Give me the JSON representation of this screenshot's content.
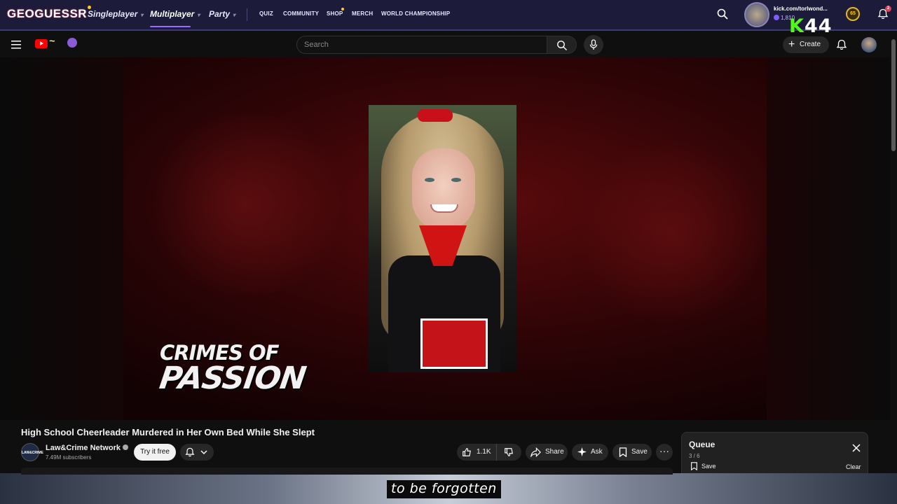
{
  "geo": {
    "logo": "GEOGUESSR",
    "nav": [
      "Singleplayer",
      "Multiplayer",
      "Party"
    ],
    "small_nav": [
      "QUIZ",
      "COMMUNITY",
      "SHOP",
      "MERCH",
      "WORLD CHAMPIONSHIP"
    ],
    "user": "kick.com/torlwond...",
    "coins": "1,810",
    "level": "65",
    "notifications": "2",
    "kick_overlay": {
      "k": "K",
      "count": "44"
    }
  },
  "yt": {
    "search_placeholder": "Search",
    "create_label": "Create"
  },
  "video": {
    "overlay_line1": "CRIMES OF",
    "overlay_line2": "PASSION",
    "title": "High School Cheerleader Murdered in Her Own Bed While She Slept",
    "channel": "Law&Crime Network",
    "channel_avatar": "LAW&CRIME",
    "subscribers": "7.49M subscribers",
    "try_label": "Try it free",
    "likes": "1.1K",
    "share_label": "Share",
    "ask_label": "Ask",
    "save_label": "Save"
  },
  "queue": {
    "title": "Queue",
    "count": "3 / 6",
    "save_label": "Save",
    "clear_label": "Clear"
  },
  "caption": "to be forgotten",
  "colors": {
    "accent": "#9b6bff",
    "kick_green": "#53fc18",
    "yt_red": "#ff0000"
  }
}
